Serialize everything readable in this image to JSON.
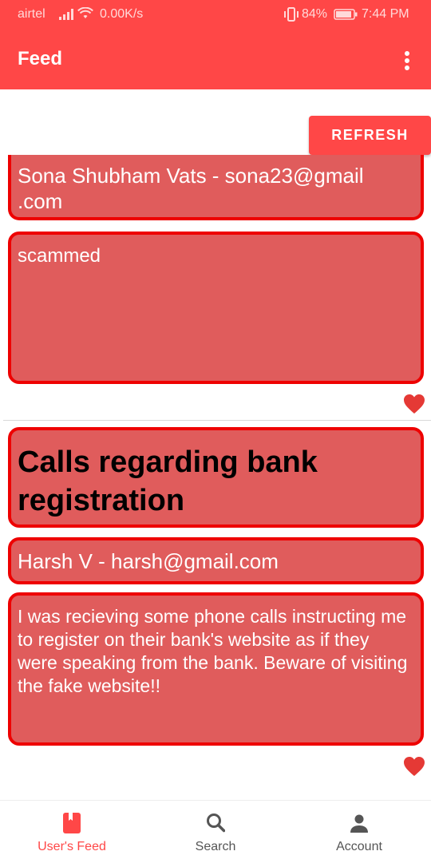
{
  "status_bar": {
    "carrier": "airtel",
    "speed": "0.00K/s",
    "battery": "84%",
    "time": "7:44 PM"
  },
  "header": {
    "title": "Feed"
  },
  "toolbar": {
    "refresh_label": "REFRESH"
  },
  "posts": [
    {
      "author": "Sona Shubham Vats - sona23@gmail\n.com",
      "body": "scammed"
    },
    {
      "title": "Calls regarding bank registration",
      "author": "Harsh V - harsh@gmail.com",
      "body": "I was recieving some phone calls instructing me to register on their bank's website as if they were speaking from the bank. Beware of visiting the fake website!!"
    }
  ],
  "bottom_nav": {
    "items": [
      {
        "label": "User's Feed",
        "icon": "book-icon",
        "active": true
      },
      {
        "label": "Search",
        "icon": "search-icon",
        "active": false
      },
      {
        "label": "Account",
        "icon": "person-icon",
        "active": false
      }
    ]
  },
  "colors": {
    "primary": "#ff4747",
    "card_fill": "#e05c5c",
    "card_border": "#ee0000",
    "heart": "#e53935",
    "inactive_nav": "#555555"
  }
}
